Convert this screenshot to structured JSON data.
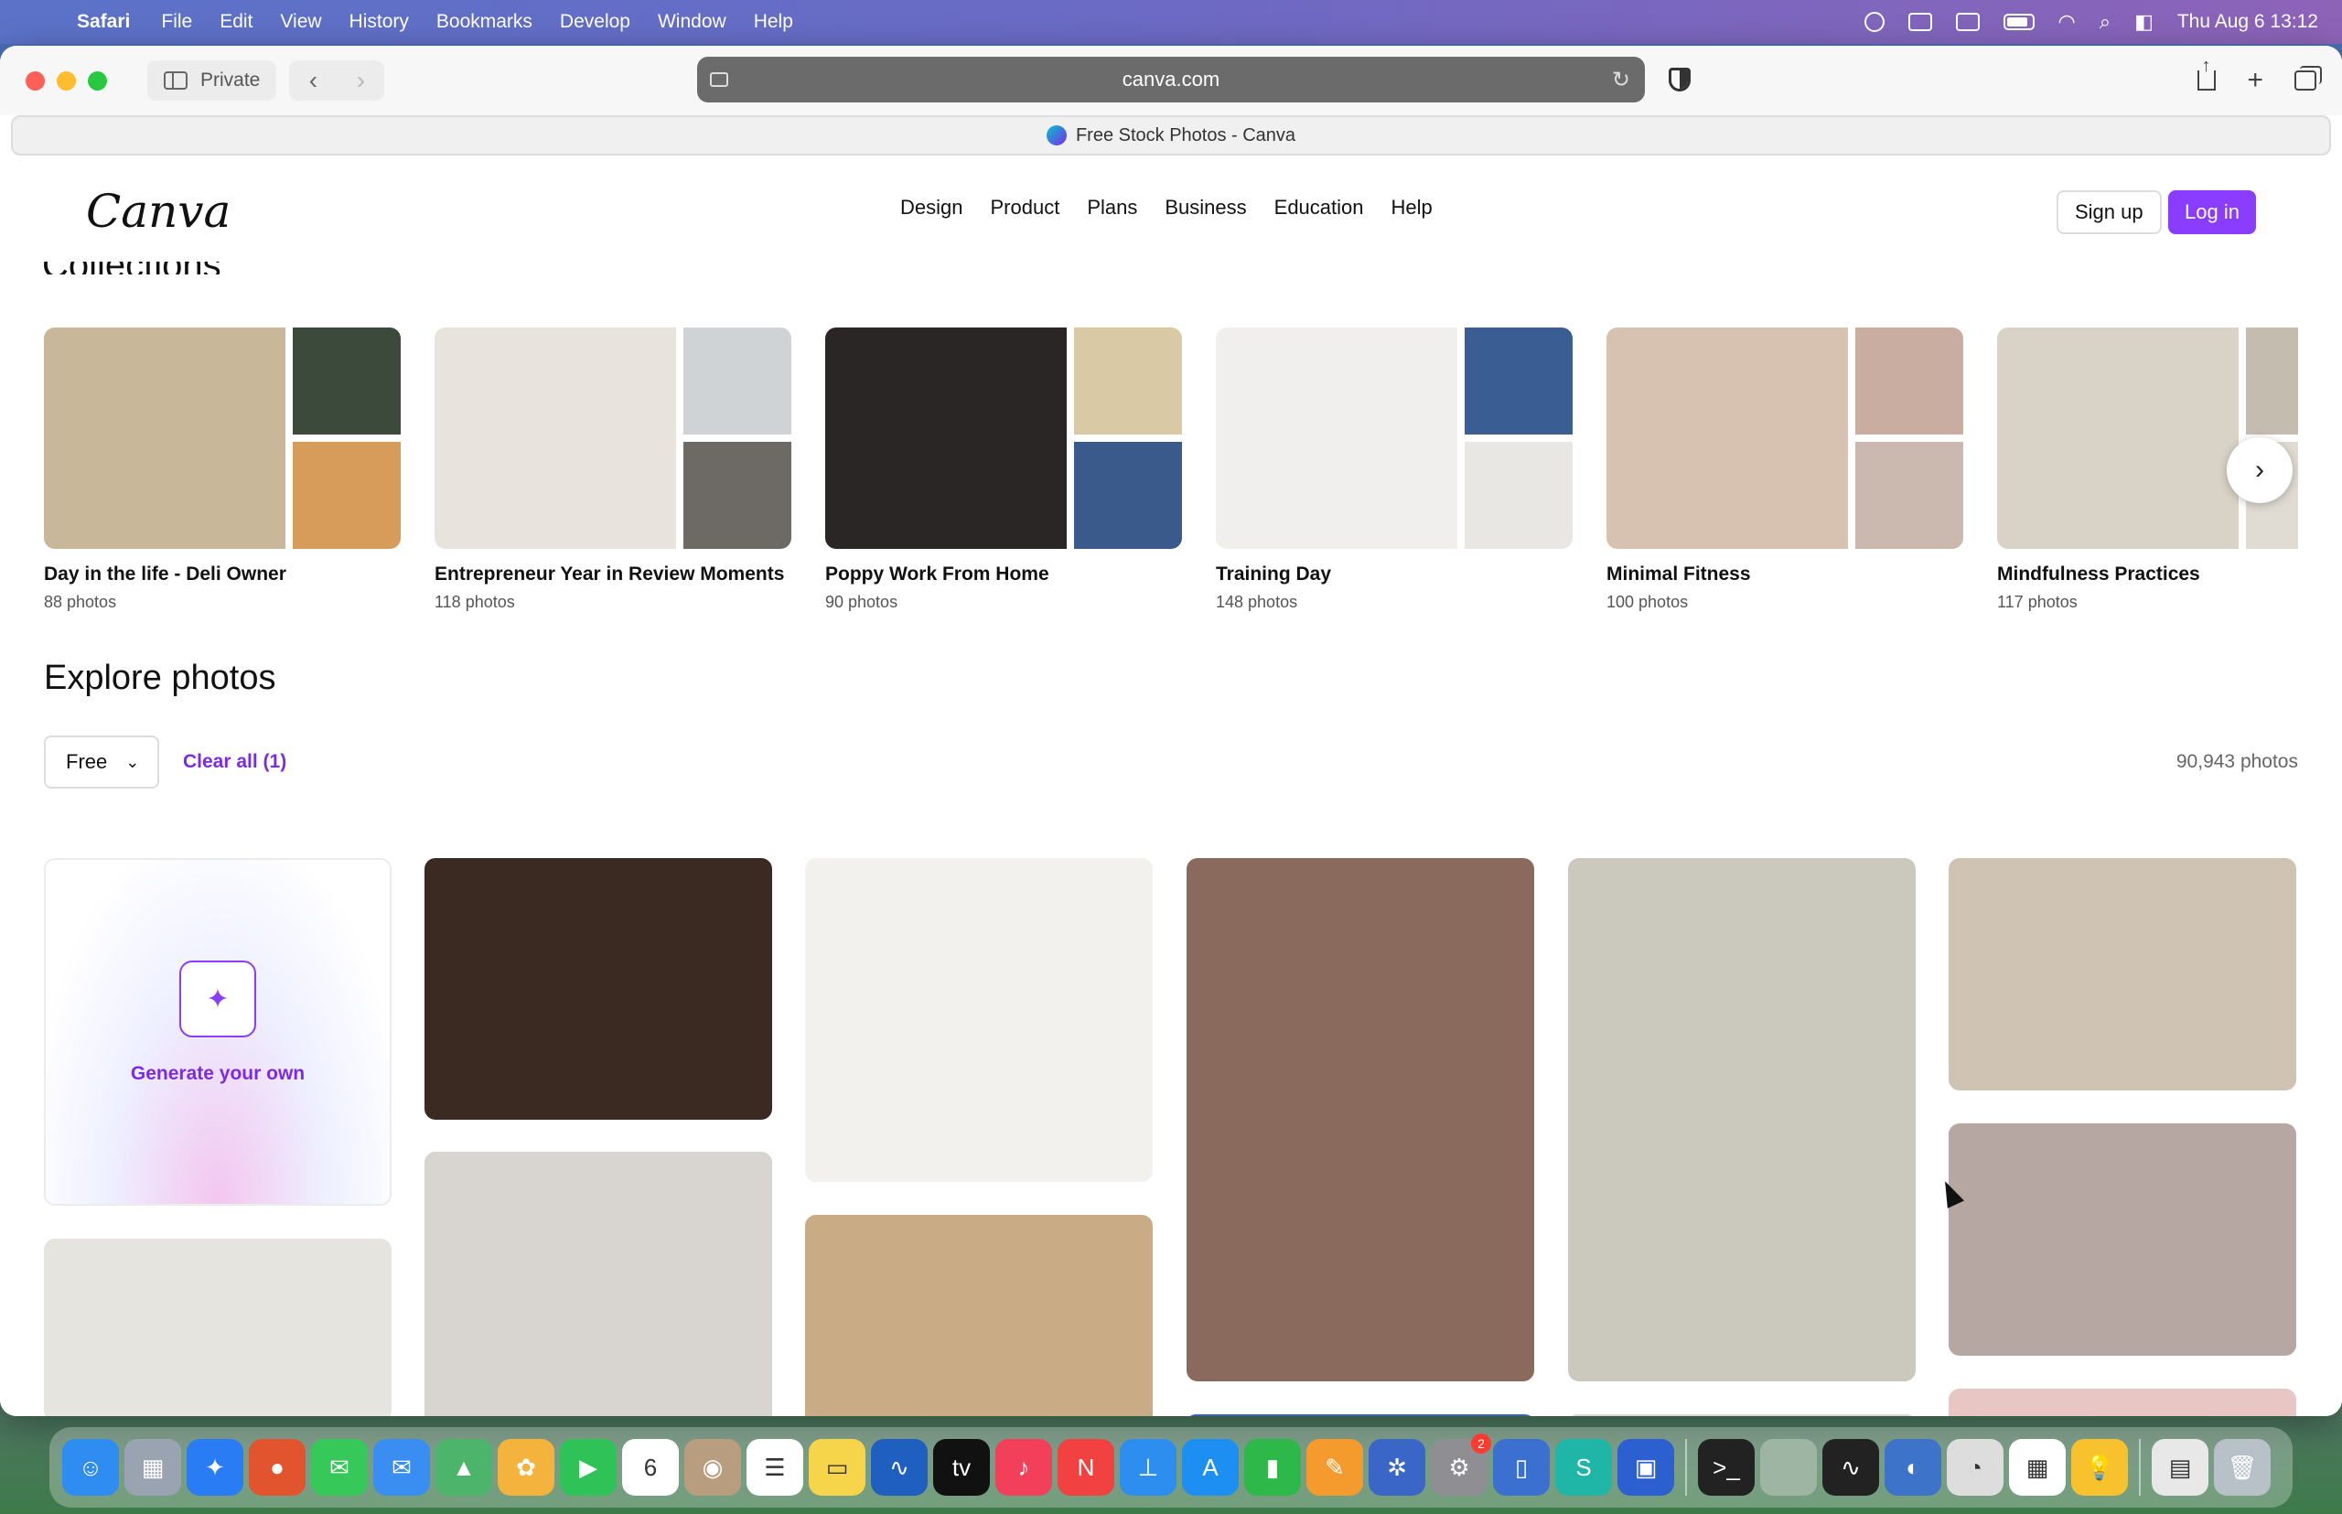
{
  "menubar": {
    "app_name": "Safari",
    "items": [
      "File",
      "Edit",
      "View",
      "History",
      "Bookmarks",
      "Develop",
      "Window",
      "Help"
    ],
    "clock": "Thu Aug 6  13:12"
  },
  "browser": {
    "private_label": "Private",
    "url": "canva.com",
    "tab_title": "Free Stock Photos - Canva"
  },
  "site": {
    "logo": "Canva",
    "nav": [
      "Design",
      "Product",
      "Plans",
      "Business",
      "Education",
      "Help"
    ],
    "signup": "Sign up",
    "login": "Log in",
    "partial_heading": "Collections"
  },
  "collections": [
    {
      "title": "Day in the life - Deli Owner",
      "count": "88 photos",
      "colors": [
        "#c9b79a",
        "#3b4a3a",
        "#d89c5a"
      ]
    },
    {
      "title": "Entrepreneur Year in Review Moments",
      "count": "118 photos",
      "colors": [
        "#e8e3dd",
        "#cfd3d6",
        "#6d6a66"
      ]
    },
    {
      "title": "Poppy Work From Home",
      "count": "90 photos",
      "colors": [
        "#2a2626",
        "#d9c9a4",
        "#3a5a8c"
      ]
    },
    {
      "title": "Training Day",
      "count": "148 photos",
      "colors": [
        "#f0efed",
        "#3a5d94",
        "#e9e7e4"
      ]
    },
    {
      "title": "Minimal Fitness",
      "count": "100 photos",
      "colors": [
        "#d7c2b2",
        "#c9ada0",
        "#cbb8ae"
      ]
    },
    {
      "title": "Mindfulness Practices",
      "count": "117 photos",
      "colors": [
        "#d9d3c7",
        "#c5bcb0",
        "#e0dbd3"
      ]
    }
  ],
  "explore": {
    "title": "Explore photos",
    "filter": "Free",
    "clear_all": "Clear all (1)",
    "count": "90,943 photos",
    "generate_label": "Generate your own"
  },
  "photo_tiles": [
    {
      "name": "coffee-desk-photo",
      "color": "#3b2a22"
    },
    {
      "name": "tulips-bag-photo",
      "color": "#d8d4cf"
    },
    {
      "name": "white-flower-photo",
      "color": "#f2f1ee"
    },
    {
      "name": "wooden-floor-photo",
      "color": "#c9ab86"
    },
    {
      "name": "rainbow-light-photo",
      "color": "#8a6a5c"
    },
    {
      "name": "blue-tile-photo",
      "color": "#3f64a8"
    },
    {
      "name": "plant-shadow-photo",
      "color": "#cbc8be"
    },
    {
      "name": "grey-tile-photo",
      "color": "#d9d6d4"
    },
    {
      "name": "book-tulips-photo",
      "color": "#cfc3b3"
    },
    {
      "name": "sky-clouds-photo",
      "color": "#b6a7a3"
    },
    {
      "name": "pink-flower-photo",
      "color": "#e7c6c4"
    },
    {
      "name": "laptop-desk-photo",
      "color": "#e6e4df"
    }
  ],
  "dock": {
    "apps": [
      {
        "name": "finder",
        "color": "#2f8cf0",
        "glyph": "☺"
      },
      {
        "name": "launchpad",
        "color": "#9aa3b2",
        "glyph": "▦"
      },
      {
        "name": "safari",
        "color": "#2a7cf5",
        "glyph": "✦"
      },
      {
        "name": "firefox",
        "color": "#e1542d",
        "glyph": "●"
      },
      {
        "name": "messages",
        "color": "#36c95a",
        "glyph": "✉"
      },
      {
        "name": "mail",
        "color": "#3a8ef2",
        "glyph": "✉"
      },
      {
        "name": "maps",
        "color": "#4cb56b",
        "glyph": "▲"
      },
      {
        "name": "photos",
        "color": "#f3b33d",
        "glyph": "✿"
      },
      {
        "name": "facetime",
        "color": "#2fc257",
        "glyph": "▶"
      },
      {
        "name": "calendar",
        "color": "#ffffff",
        "glyph": "6"
      },
      {
        "name": "contacts",
        "color": "#b89e7e",
        "glyph": "◉"
      },
      {
        "name": "reminders",
        "color": "#ffffff",
        "glyph": "☰"
      },
      {
        "name": "notes",
        "color": "#f7d54a",
        "glyph": "▭"
      },
      {
        "name": "freeform",
        "color": "#1f5fbf",
        "glyph": "∿"
      },
      {
        "name": "tv",
        "color": "#111111",
        "glyph": "tv"
      },
      {
        "name": "music",
        "color": "#f2405a",
        "glyph": "♪"
      },
      {
        "name": "news",
        "color": "#f24141",
        "glyph": "N"
      },
      {
        "name": "keynote",
        "color": "#2d8ef0",
        "glyph": "⊥"
      },
      {
        "name": "app-store",
        "color": "#1e8ff2",
        "glyph": "A"
      },
      {
        "name": "numbers",
        "color": "#2fb84a",
        "glyph": "▮"
      },
      {
        "name": "pages",
        "color": "#f59b2d",
        "glyph": "✎"
      },
      {
        "name": "perplexity",
        "color": "#3a66c8",
        "glyph": "✲"
      },
      {
        "name": "system-settings",
        "color": "#8e8e93",
        "glyph": "⚙"
      },
      {
        "name": "simulator",
        "color": "#3b6fd0",
        "glyph": "▯"
      },
      {
        "name": "surfshark",
        "color": "#1fb6a8",
        "glyph": "S"
      },
      {
        "name": "parallels",
        "color": "#2c5fcf",
        "glyph": "▣"
      },
      {
        "name": "terminal",
        "color": "#222222",
        "glyph": ">_"
      },
      {
        "name": "window-thumbnail",
        "color": "#9fb5a4",
        "glyph": ""
      },
      {
        "name": "activity-monitor",
        "color": "#222222",
        "glyph": "∿"
      },
      {
        "name": "preview",
        "color": "#3d73c9",
        "glyph": "◐"
      },
      {
        "name": "disk-utility",
        "color": "#dddddd",
        "glyph": "◔"
      },
      {
        "name": "chart-thumbnail",
        "color": "#ffffff",
        "glyph": "▦"
      },
      {
        "name": "tips",
        "color": "#f7c22e",
        "glyph": "💡"
      },
      {
        "name": "downloads-stack",
        "color": "#e8e8e8",
        "glyph": "▤"
      },
      {
        "name": "trash",
        "color": "#b8c0c8",
        "glyph": "🗑"
      }
    ],
    "settings_badge": "2"
  }
}
